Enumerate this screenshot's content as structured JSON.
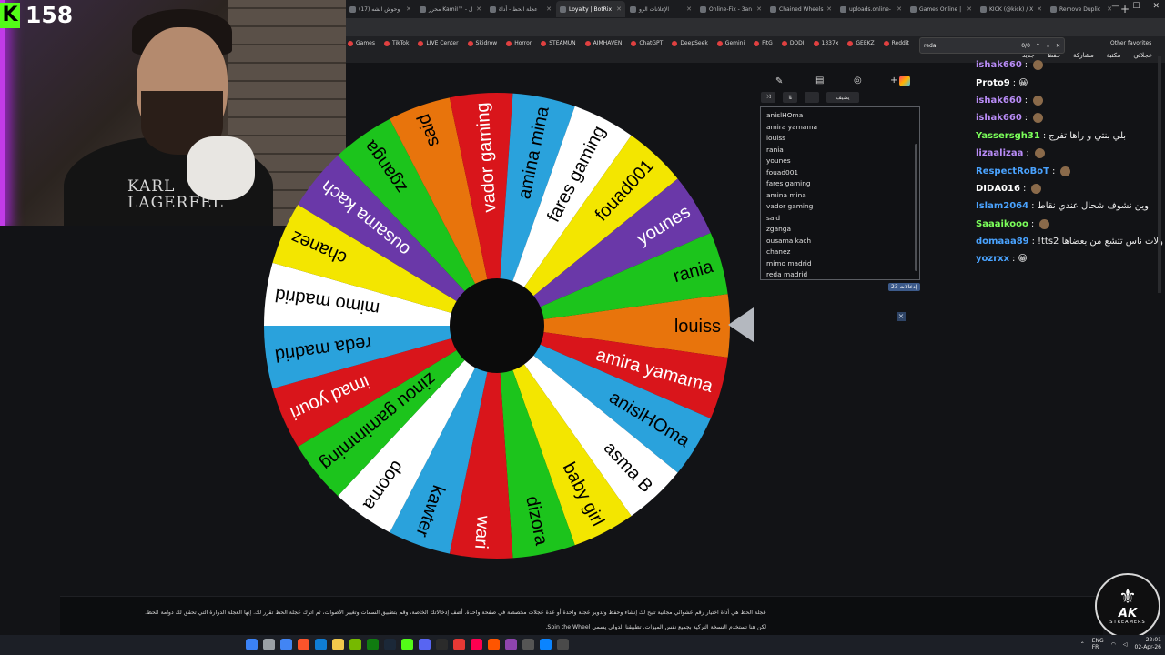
{
  "browser": {
    "tabs": [
      {
        "label": "(17) وحوش الشه"
      },
      {
        "label": "محرر KamiI™ - ل"
      },
      {
        "label": "عجلة الحظ - أداة"
      },
      {
        "label": "Loyalty | BotRix"
      },
      {
        "label": "الإعلانات الرو"
      },
      {
        "label": "Online-Fix - 3an"
      },
      {
        "label": "Chained Wheels"
      },
      {
        "label": "uploads.online-"
      },
      {
        "label": "Games Online |"
      },
      {
        "label": "KICK (@kick) / X"
      },
      {
        "label": "Remove Duplic"
      }
    ],
    "active_tab_index": 3,
    "bookmarks": [
      "Games",
      "TikTok",
      "LIVE Center",
      "Skidrow",
      "Horror",
      "STEAMUN",
      "AIMHAVEN",
      "ChatGPT",
      "DeepSeek",
      "Gemini",
      "FitG",
      "DODI",
      "1337x",
      "GEEKZ",
      "Reddit"
    ],
    "other_favorites": "Other favorites",
    "find": {
      "query": "reda",
      "count": "0/0"
    }
  },
  "webcam": {
    "kick_count": "158",
    "shirt_line1": "KARL",
    "shirt_line2": "LAGERFEL"
  },
  "wheel": {
    "segments": [
      {
        "label": "louiss",
        "color": "#e8740c",
        "text": "#000000"
      },
      {
        "label": "amira yamama",
        "color": "#d9151b",
        "text": "#ffffff"
      },
      {
        "label": "anislHOma",
        "color": "#2aa2dc",
        "text": "#000000"
      },
      {
        "label": "asma B",
        "color": "#ffffff",
        "text": "#000000"
      },
      {
        "label": "baby girl",
        "color": "#f3e600",
        "text": "#000000"
      },
      {
        "label": "dizora",
        "color": "#1cc41c",
        "text": "#000000"
      },
      {
        "label": "wari",
        "color": "#d9151b",
        "text": "#ffffff"
      },
      {
        "label": "kawter",
        "color": "#2aa2dc",
        "text": "#000000"
      },
      {
        "label": "dooma",
        "color": "#ffffff",
        "text": "#000000"
      },
      {
        "label": "zinou gamimming",
        "color": "#1cc41c",
        "text": "#000000"
      },
      {
        "label": "imad youri",
        "color": "#d9151b",
        "text": "#ffffff"
      },
      {
        "label": "reda madrid",
        "color": "#2aa2dc",
        "text": "#000000"
      },
      {
        "label": "mimo madrid",
        "color": "#ffffff",
        "text": "#000000"
      },
      {
        "label": "chanez",
        "color": "#f3e600",
        "text": "#000000"
      },
      {
        "label": "ousama kach",
        "color": "#6a38a8",
        "text": "#ffffff"
      },
      {
        "label": "zganga",
        "color": "#1cc41c",
        "text": "#000000"
      },
      {
        "label": "said",
        "color": "#e8740c",
        "text": "#000000"
      },
      {
        "label": "vador gaming",
        "color": "#d9151b",
        "text": "#ffffff"
      },
      {
        "label": "amina mina",
        "color": "#2aa2dc",
        "text": "#000000"
      },
      {
        "label": "fares gaming",
        "color": "#ffffff",
        "text": "#000000"
      },
      {
        "label": "fouad001",
        "color": "#f3e600",
        "text": "#000000"
      },
      {
        "label": "younes",
        "color": "#6a38a8",
        "text": "#ffffff"
      },
      {
        "label": "rania",
        "color": "#1cc41c",
        "text": "#000000"
      }
    ]
  },
  "panel": {
    "shuffle_label": "⤨",
    "sort_label": "⇅",
    "add_image_label": "يضيف",
    "entries": [
      "anislHOma",
      "amira yamama",
      "louiss",
      "rania",
      "younes",
      "fouad001",
      "fares gaming",
      "amina mina",
      "vador gaming",
      "said",
      "zganga",
      "ousama kach",
      "chanez",
      "mimo madrid",
      "reda madrid"
    ],
    "entry_count": "إدخالات 23",
    "close": "×"
  },
  "topnav": {
    "items": [
      "عجلاتي",
      "مكتبة",
      "مشاركة",
      "حفظ",
      "جديد"
    ]
  },
  "chat": [
    {
      "user": "ishak660",
      "color": "#b98cf7",
      "text": ""
    },
    {
      "user": "Proto9",
      "color": "#ffffff",
      "text": "😀"
    },
    {
      "user": "ishak660",
      "color": "#b98cf7",
      "text": ""
    },
    {
      "user": "ishak660",
      "color": "#b98cf7",
      "text": ""
    },
    {
      "user": "Yassersgh31",
      "color": "#7bff5a",
      "text": "بلي بنتي و راها تفرج"
    },
    {
      "user": "lizaalizaa",
      "color": "#b98cf7",
      "text": ""
    },
    {
      "user": "RespectRoBoT",
      "color": "#4aa3ff",
      "text": ""
    },
    {
      "user": "DIDA016",
      "color": "#ffffff",
      "text": ""
    },
    {
      "user": "Islam2064",
      "color": "#4aa3ff",
      "text": "وين نشوف شحال عندي نقاط"
    },
    {
      "user": "Saaaikooo",
      "color": "#7bff5a",
      "text": ""
    },
    {
      "user": "domaaa89",
      "color": "#4aa3ff",
      "text": "!tts2 و ولات ناس تتشع من بعضاها"
    },
    {
      "user": "yozrxx",
      "color": "#4aa3ff",
      "text": "😀"
    }
  ],
  "footer": {
    "line1": "عجلة الحظ هي أداة اختيار رقم عشوائي مجانية تتيح لك إنشاء وحفظ وتدوير عجلة واحدة أو عدة عجلات مخصصة في صفحة واحدة. أضف إدخالاتك الخاصة، وقم بتطبيق السمات وتغيير الأصوات، ثم اترك عجلة الحظ تقرر لك. إنها العجلة الدوارة التي تحقق لك دوامة الحظ.",
    "line2": "لكن هنا تستخدم النسخة التركية بجميع نفس الميزات. تطبيقنا الدولي يسمى Spin the Wheel."
  },
  "logo": {
    "title": "AK",
    "subtitle": "STREAMERS"
  },
  "taskbar": {
    "lang1": "ENG",
    "lang2": "FR",
    "time": "22:01",
    "date": "02-Apr-26"
  }
}
